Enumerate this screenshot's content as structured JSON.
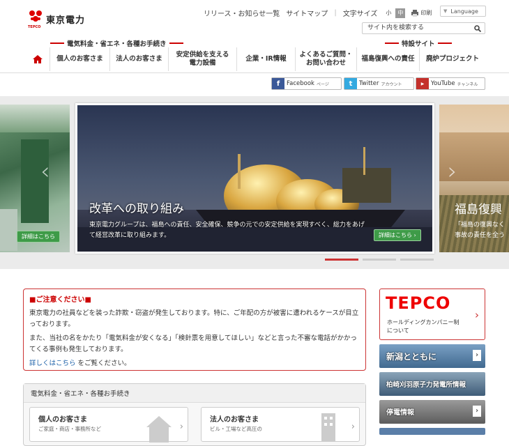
{
  "brand": {
    "name": "東京電力",
    "sub": "TEPCO"
  },
  "toplinks": {
    "release": "リリース・お知らせ一覧",
    "sitemap": "サイトマップ",
    "textsize": "文字サイズ",
    "size_small": "小",
    "size_mid": "中",
    "print": "印刷",
    "language": "Language"
  },
  "search": {
    "placeholder": "サイト内を検索する"
  },
  "categories": {
    "left": "電気料金・省エネ・各種お手続き",
    "right": "特設サイト"
  },
  "nav": [
    {
      "label": "個人のお客さま"
    },
    {
      "label": "法人のお客さま"
    },
    {
      "label": "安定供給を支える\n電力設備"
    },
    {
      "label": "企業・IR情報"
    },
    {
      "label": "よくあるご質問・\nお問い合わせ"
    },
    {
      "label": "福島復興への責任"
    },
    {
      "label": "廃炉プロジェクト"
    }
  ],
  "social": {
    "facebook": {
      "label": "Facebook",
      "sub": "ページ"
    },
    "twitter": {
      "label": "Twitter",
      "sub": "アカウント"
    },
    "youtube": {
      "label": "YouTube",
      "sub": "チャンネル"
    }
  },
  "slider": {
    "main_title": "改革への取り組み",
    "main_desc": "東京電力グループは、福島への責任、安全確保、競争の元での安定供給を実現すべく、総力をあげて経営改革に取り組みます。",
    "detail": "詳細はこちら",
    "right_title": "福島復興",
    "right_desc": "「福島の復興なく\n事故の責任を全う"
  },
  "notice": {
    "title": "■ご注意ください■",
    "p1": "東京電力の社員などを装った詐欺・窃盗が発生しております。特に、ご年配の方が被害に遭われるケースが目立っております。",
    "p2": "また、当社の名をかたり「電気料金が安くなる」「検針票を用意してほしい」などと言った不審な電話がかかってくる事例も発生しております。",
    "link": "詳しくはこちら",
    "link_suffix": "をご覧ください。"
  },
  "panel": {
    "title": "電気料金・省エネ・各種お手続き",
    "card1": {
      "title": "個人のお客さま",
      "sub": "ご家庭・商店・事務所など"
    },
    "card2": {
      "title": "法人のお客さま",
      "sub": "ビル・工場など高圧の"
    }
  },
  "banners": {
    "tepco_logo": "TEPCO",
    "tepco_text": "ホールディングカンパニー制\nについて",
    "niigata": "新潟とともに",
    "kashiwazaki": "柏崎刈羽原子力発電所情報",
    "outage": "停電情報"
  }
}
